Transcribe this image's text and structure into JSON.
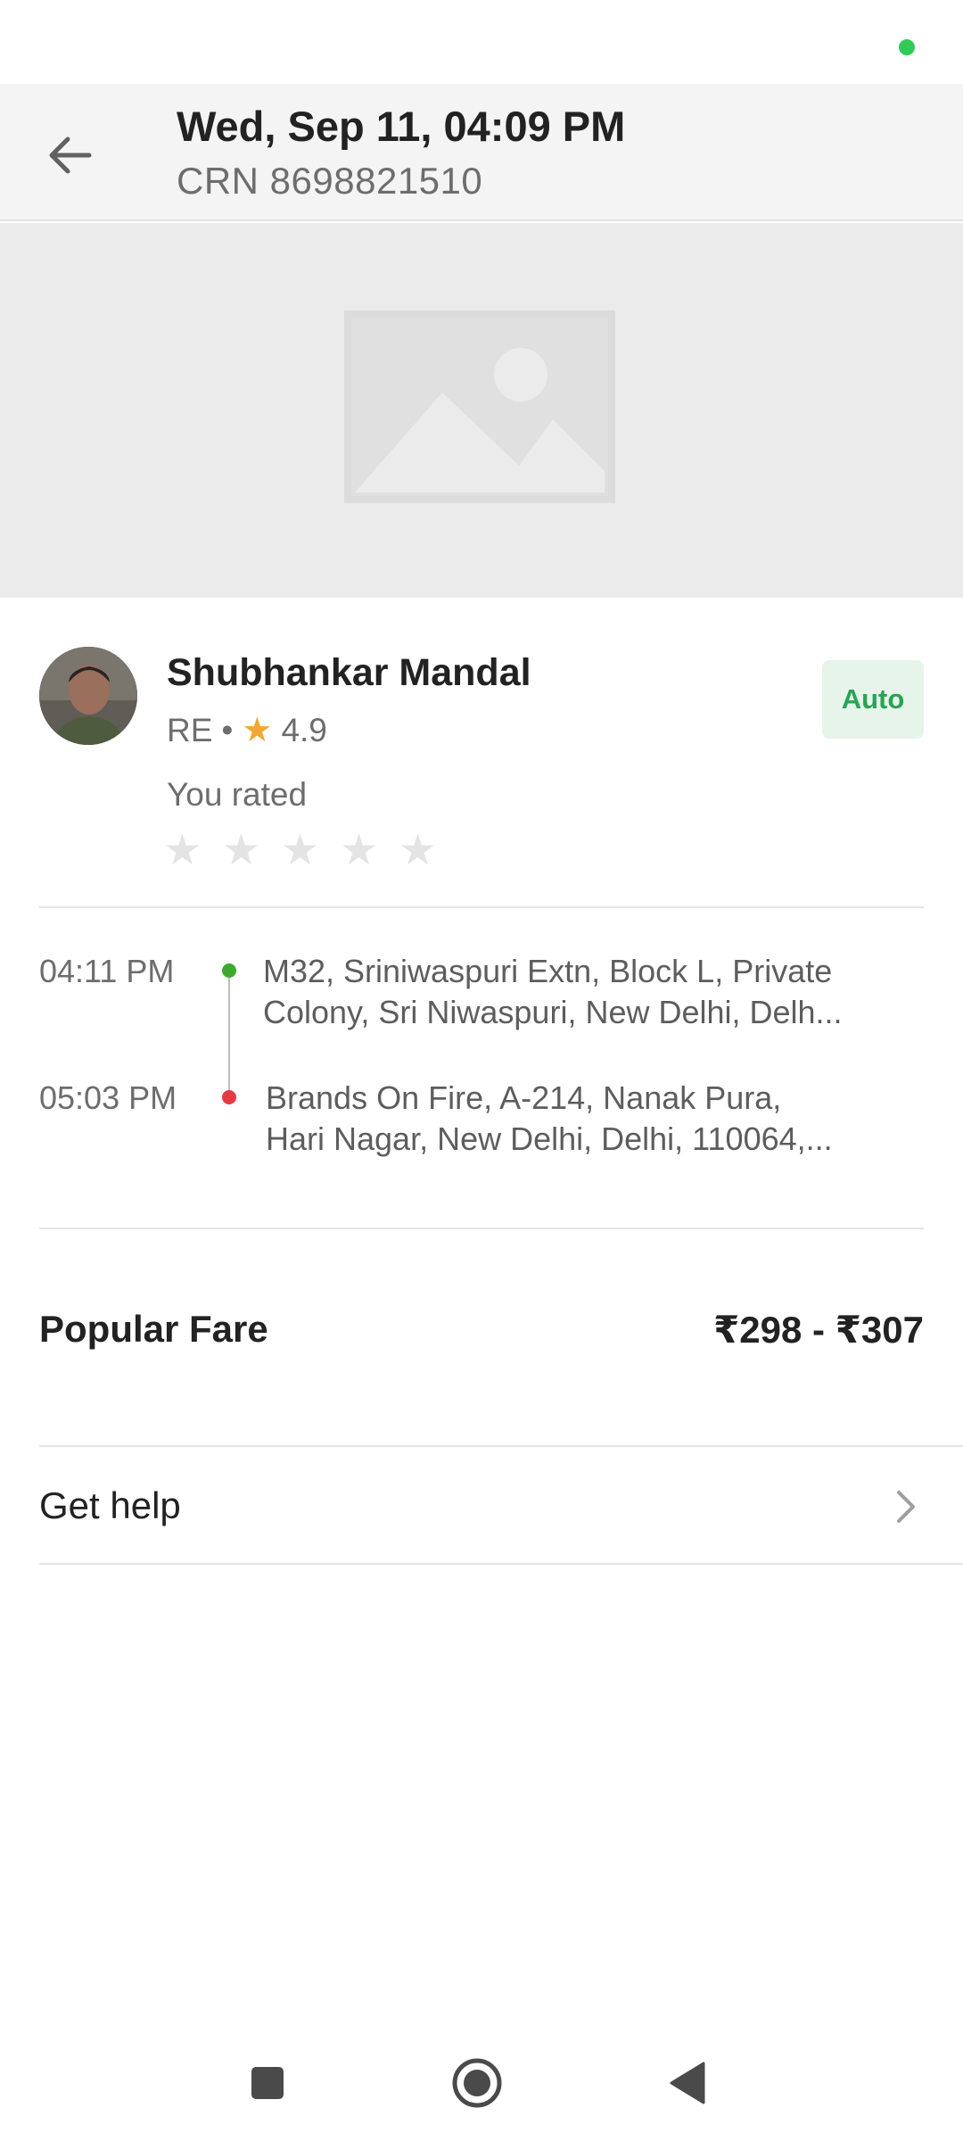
{
  "header": {
    "title": "Wed, Sep 11, 04:09 PM",
    "crn": "CRN 8698821510"
  },
  "driver": {
    "name": "Shubhankar Mandal",
    "code": "RE",
    "separator": "•",
    "rating": "4.9",
    "vehicle_type": "Auto",
    "you_rated_label": "You rated",
    "user_rating": 0
  },
  "trip": {
    "pickup": {
      "time": "04:11 PM",
      "address_line1": "M32, Sriniwaspuri Extn, Block L, Private",
      "address_line2": "Colony, Sri Niwaspuri, New Delhi, Delh..."
    },
    "drop": {
      "time": "05:03 PM",
      "address_line1": "Brands On Fire, A-214, Nanak Pura,",
      "address_line2": "Hari Nagar, New Delhi, Delhi, 110064,..."
    }
  },
  "fare": {
    "label": "Popular Fare",
    "value": "₹298 - ₹307"
  },
  "help": {
    "label": "Get help"
  },
  "colors": {
    "accent_green": "#28a454",
    "pickup_pin": "#3daa2f",
    "drop_pin": "#e33b41",
    "star": "#f3a633"
  },
  "icons": {
    "back": "arrow-left-icon",
    "map": "image-placeholder-icon",
    "chevron": "chevron-right-icon",
    "nav_recents": "square-icon",
    "nav_home": "circle-icon",
    "nav_back": "triangle-back-icon"
  }
}
